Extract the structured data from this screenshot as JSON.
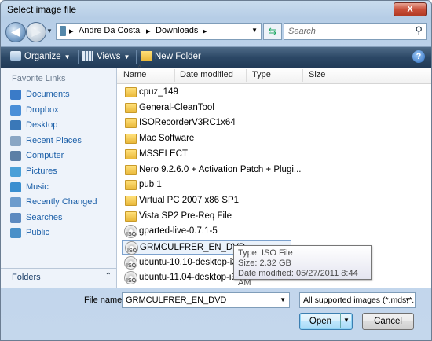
{
  "window": {
    "title": "Select image file",
    "close_label": "X"
  },
  "nav": {
    "breadcrumbs": [
      "Andre Da Costa",
      "Downloads"
    ],
    "search_placeholder": "Search"
  },
  "toolbar": {
    "organize": "Organize",
    "views": "Views",
    "new_folder": "New Folder",
    "help": "?"
  },
  "left_pane": {
    "heading": "Favorite Links",
    "items": [
      {
        "label": "Documents",
        "icon": "documents-icon",
        "color": "#3a7bc8"
      },
      {
        "label": "Dropbox",
        "icon": "dropbox-icon",
        "color": "#4a8fd8"
      },
      {
        "label": "Desktop",
        "icon": "desktop-icon",
        "color": "#3a78b8"
      },
      {
        "label": "Recent Places",
        "icon": "recent-places-icon",
        "color": "#8aa6c4"
      },
      {
        "label": "Computer",
        "icon": "computer-icon",
        "color": "#5c7fa6"
      },
      {
        "label": "Pictures",
        "icon": "pictures-icon",
        "color": "#4aa0d8"
      },
      {
        "label": "Music",
        "icon": "music-icon",
        "color": "#3a8fd0"
      },
      {
        "label": "Recently Changed",
        "icon": "recently-changed-icon",
        "color": "#6d9ccd"
      },
      {
        "label": "Searches",
        "icon": "searches-icon",
        "color": "#5d8ac0"
      },
      {
        "label": "Public",
        "icon": "public-icon",
        "color": "#4a90c8"
      }
    ],
    "folders_label": "Folders"
  },
  "columns": [
    "Name",
    "Date modified",
    "Type",
    "Size"
  ],
  "files": [
    {
      "name": "cpuz_149",
      "kind": "folder"
    },
    {
      "name": "General-CleanTool",
      "kind": "folder"
    },
    {
      "name": "ISORecorderV3RC1x64",
      "kind": "folder"
    },
    {
      "name": "Mac Software",
      "kind": "folder"
    },
    {
      "name": "MSSELECT",
      "kind": "folder"
    },
    {
      "name": "Nero 9.2.6.0 + Activation Patch + Plugi...",
      "kind": "folder"
    },
    {
      "name": "pub 1",
      "kind": "folder"
    },
    {
      "name": "Virtual PC 2007 x86 SP1",
      "kind": "folder"
    },
    {
      "name": "Vista SP2 Pre-Req File",
      "kind": "folder"
    },
    {
      "name": "gparted-live-0.7.1-5",
      "kind": "iso"
    },
    {
      "name": "GRMCULFRER_EN_DVD",
      "kind": "iso",
      "selected": true
    },
    {
      "name": "ubuntu-10.10-desktop-i38",
      "kind": "iso"
    },
    {
      "name": "ubuntu-11.04-desktop-i38",
      "kind": "iso"
    }
  ],
  "iso_label": "ISO",
  "tooltip": {
    "type": "Type: ISO File",
    "size": "Size: 2.32 GB",
    "date": "Date modified: 05/27/2011 8:44 AM"
  },
  "bottom": {
    "file_name_label": "File name:",
    "file_name_value": "GRMCULFRER_EN_DVD",
    "filter_value": "All supported images (*.mds;*.",
    "open_label": "Open",
    "cancel_label": "Cancel"
  }
}
